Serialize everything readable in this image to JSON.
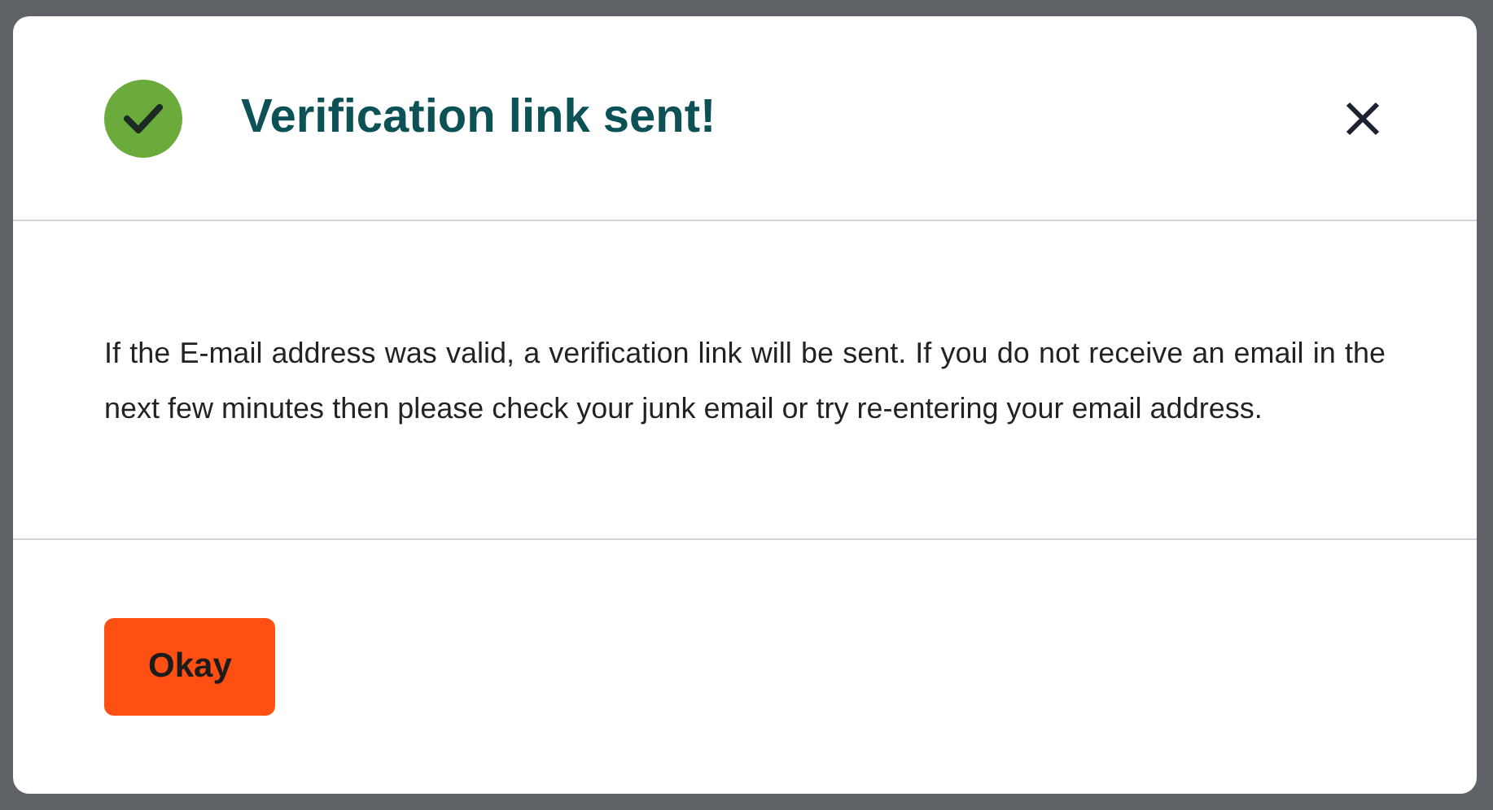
{
  "dialog": {
    "title": "Verification link sent!",
    "message": "If the E-mail address was valid, a verification link will be sent. If you do not receive an email in the next few minutes then please check your junk email or try re-entering your email address.",
    "buttons": [
      "Okay"
    ]
  }
}
